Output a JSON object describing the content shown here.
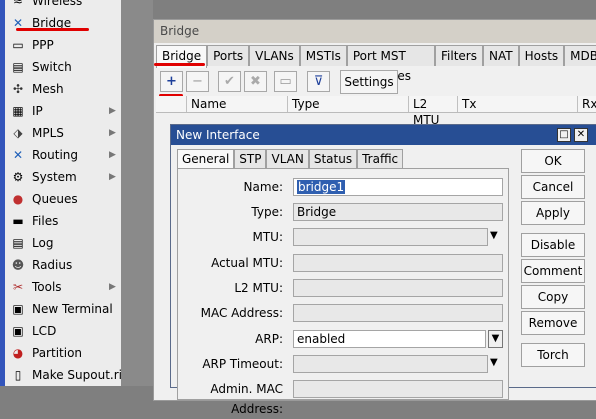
{
  "menu": {
    "items": [
      {
        "label": "Wireless",
        "icon": "wireless-icon",
        "glyph": "≈",
        "arrow": false
      },
      {
        "label": "Bridge",
        "icon": "bridge-icon",
        "glyph": "✕",
        "arrow": false
      },
      {
        "label": "PPP",
        "icon": "ppp-icon",
        "glyph": "▭",
        "arrow": false
      },
      {
        "label": "Switch",
        "icon": "switch-icon",
        "glyph": "▤",
        "arrow": false
      },
      {
        "label": "Mesh",
        "icon": "mesh-icon",
        "glyph": "✣",
        "arrow": false
      },
      {
        "label": "IP",
        "icon": "ip-icon",
        "glyph": "▦",
        "arrow": true
      },
      {
        "label": "MPLS",
        "icon": "mpls-icon",
        "glyph": "⬗",
        "arrow": true
      },
      {
        "label": "Routing",
        "icon": "routing-icon",
        "glyph": "✕",
        "arrow": true
      },
      {
        "label": "System",
        "icon": "system-icon",
        "glyph": "⚙",
        "arrow": true
      },
      {
        "label": "Queues",
        "icon": "queues-icon",
        "glyph": "●",
        "arrow": false
      },
      {
        "label": "Files",
        "icon": "files-icon",
        "glyph": "▬",
        "arrow": false
      },
      {
        "label": "Log",
        "icon": "log-icon",
        "glyph": "▤",
        "arrow": false
      },
      {
        "label": "Radius",
        "icon": "radius-icon",
        "glyph": "☻",
        "arrow": false
      },
      {
        "label": "Tools",
        "icon": "tools-icon",
        "glyph": "✂",
        "arrow": true
      },
      {
        "label": "New Terminal",
        "icon": "terminal-icon",
        "glyph": "▣",
        "arrow": false
      },
      {
        "label": "LCD",
        "icon": "lcd-icon",
        "glyph": "▣",
        "arrow": false
      },
      {
        "label": "Partition",
        "icon": "partition-icon",
        "glyph": "◕",
        "arrow": false
      },
      {
        "label": "Make Supout.rif",
        "icon": "supout-icon",
        "glyph": "▯",
        "arrow": false
      }
    ]
  },
  "bridge_window": {
    "title": "Bridge",
    "tabs": [
      "Bridge",
      "Ports",
      "VLANs",
      "MSTIs",
      "Port MST Overrides",
      "Filters",
      "NAT",
      "Hosts",
      "MDB"
    ],
    "toolbar": {
      "add": "+",
      "remove": "−",
      "enable": "✔",
      "disable": "✖",
      "comment": "▭",
      "filter": "⊽",
      "settings": "Settings"
    },
    "columns": [
      "Name",
      "Type",
      "L2 MTU",
      "Tx",
      "Rx"
    ]
  },
  "dialog": {
    "title": "New Interface",
    "window_buttons": {
      "maximize": "□",
      "close": "✕"
    },
    "tabs": [
      "General",
      "STP",
      "VLAN",
      "Status",
      "Traffic"
    ],
    "fields": {
      "name": {
        "label": "Name:",
        "value": "bridge1"
      },
      "type": {
        "label": "Type:",
        "value": "Bridge"
      },
      "mtu": {
        "label": "MTU:",
        "value": ""
      },
      "actual_mtu": {
        "label": "Actual MTU:",
        "value": ""
      },
      "l2_mtu": {
        "label": "L2 MTU:",
        "value": ""
      },
      "mac_address": {
        "label": "MAC Address:",
        "value": ""
      },
      "arp": {
        "label": "ARP:",
        "value": "enabled"
      },
      "arp_timeout": {
        "label": "ARP Timeout:",
        "value": ""
      },
      "admin_mac": {
        "label": "Admin. MAC Address:",
        "value": ""
      }
    },
    "buttons": [
      "OK",
      "Cancel",
      "Apply",
      "Disable",
      "Comment",
      "Copy",
      "Remove",
      "Torch"
    ]
  },
  "colors": {
    "accent_red": "#e00000",
    "dialog_title": "#274e94",
    "left_strip": "#3355bb"
  }
}
